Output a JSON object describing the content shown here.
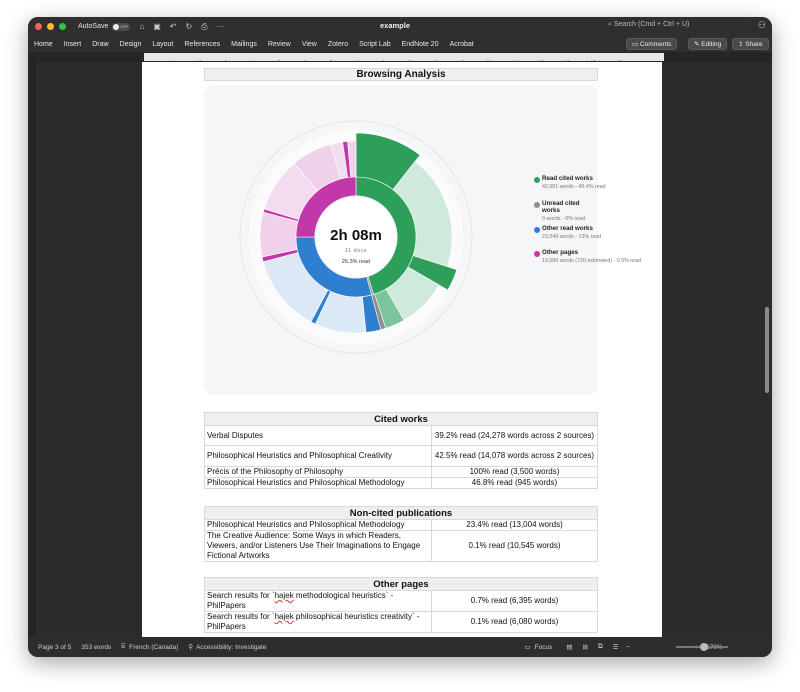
{
  "titlebar": {
    "autosave": "AutoSave",
    "autosave_state": "OFF",
    "doc_title": "example",
    "search_placeholder": "Search (Cmd + Ctrl + U)"
  },
  "ribbon": {
    "tabs": [
      "Home",
      "Insert",
      "Draw",
      "Design",
      "Layout",
      "References",
      "Mailings",
      "Review",
      "View",
      "Zotero",
      "Script Lab",
      "EndNote 20",
      "Acrobat"
    ],
    "comments": "Comments",
    "editing": "Editing",
    "share": "Share"
  },
  "ruler_numbers": [
    "1",
    "2",
    "3",
    "4",
    "5",
    "6",
    "7",
    "8",
    "9",
    "10",
    "11",
    "12",
    "13",
    "14",
    "15",
    "16",
    "17",
    "18"
  ],
  "document": {
    "browsing_title": "Browsing Analysis",
    "center_time": "2h 08m",
    "center_docs": "11 docs",
    "center_read": "26.3% read",
    "legend": [
      {
        "title": "Read cited works",
        "sub": "42,601 words - 45.4% read",
        "color": "#2e9e5b"
      },
      {
        "title": "Unread cited works",
        "sub": "0 words - 0% read",
        "color": "#8e8e8e"
      },
      {
        "title": "Other read works",
        "sub": "23,549 words - 13% read",
        "color": "#2f7fd0"
      },
      {
        "title": "Other pages",
        "sub": "19,589 words (720 estimated) - 0.5% read",
        "color": "#c238a8"
      }
    ],
    "cited_header": "Cited works",
    "cited_rows": [
      {
        "title": "Verbal Disputes",
        "value": "39.2% read (24,278 words across 2 sources)"
      },
      {
        "title": "Philosophical Heuristics and Philosophical Creativity",
        "value": "42.5% read (14,078 words across 2 sources)"
      },
      {
        "title": "Précis of the Philosophy of Philosophy",
        "value": "100% read (3,500 words)"
      },
      {
        "title": "Philosophical Heuristics and Philosophical Methodology",
        "value": "46.8% read (945 words)"
      }
    ],
    "noncited_header": "Non-cited publications",
    "noncited_rows": [
      {
        "title": "Philosophical Heuristics and Philosophical Methodology",
        "value": "23.4% read (13,004 words)"
      },
      {
        "title": "The Creative Audience: Some Ways in which Readers, Viewers, and/or Listeners Use Their Imaginations to Engage Fictional Artworks",
        "value": "0.1% read (10,545 words)"
      }
    ],
    "other_header": "Other pages",
    "other_rows": [
      {
        "pre": "Search results for `",
        "sq": "hajek",
        "post": " methodological heuristics` - PhilPapers",
        "value": "0.7% read (6,395 words)"
      },
      {
        "pre": "Search results for `",
        "sq": "hajek",
        "post": " philosophical heuristics creativity` - PhilPapers",
        "value": "0.1% read (6,080 words)"
      }
    ]
  },
  "statusbar": {
    "page": "Page 3 of 5",
    "words": "353 words",
    "language": "French (Canada)",
    "accessibility": "Accessibility: Investigate",
    "focus": "Focus",
    "zoom": "170%"
  }
}
